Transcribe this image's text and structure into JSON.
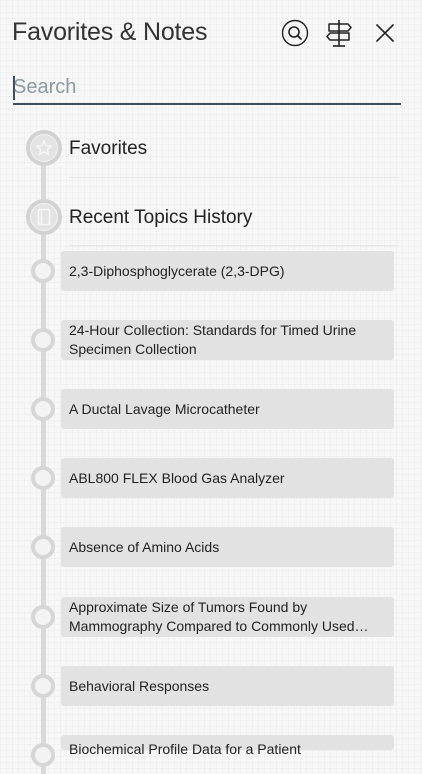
{
  "header": {
    "title": "Favorites & Notes"
  },
  "search": {
    "placeholder": "Search",
    "value": ""
  },
  "sections": [
    {
      "label": "Favorites",
      "icon": "star-icon"
    },
    {
      "label": "Recent Topics History",
      "icon": "book-icon"
    }
  ],
  "history": [
    "2,3-Diphosphoglycerate (2,3-DPG)",
    "24-Hour Collection: Standards for Timed Urine Specimen Collection",
    "A Ductal Lavage Microcatheter",
    "ABL800 FLEX Blood Gas Analyzer",
    "Absence of Amino Acids",
    "Approximate Size of Tumors Found by Mammography Compared to Commonly Used…",
    "Behavioral Responses",
    "Biochemical Profile Data for a Patient"
  ],
  "icons": {
    "search": "search-icon",
    "signpost": "signpost-icon",
    "close": "close-icon"
  },
  "colors": {
    "accent": "#3d4f57",
    "item_bg": "#e2e2e2",
    "timeline": "#d9d9d9"
  }
}
